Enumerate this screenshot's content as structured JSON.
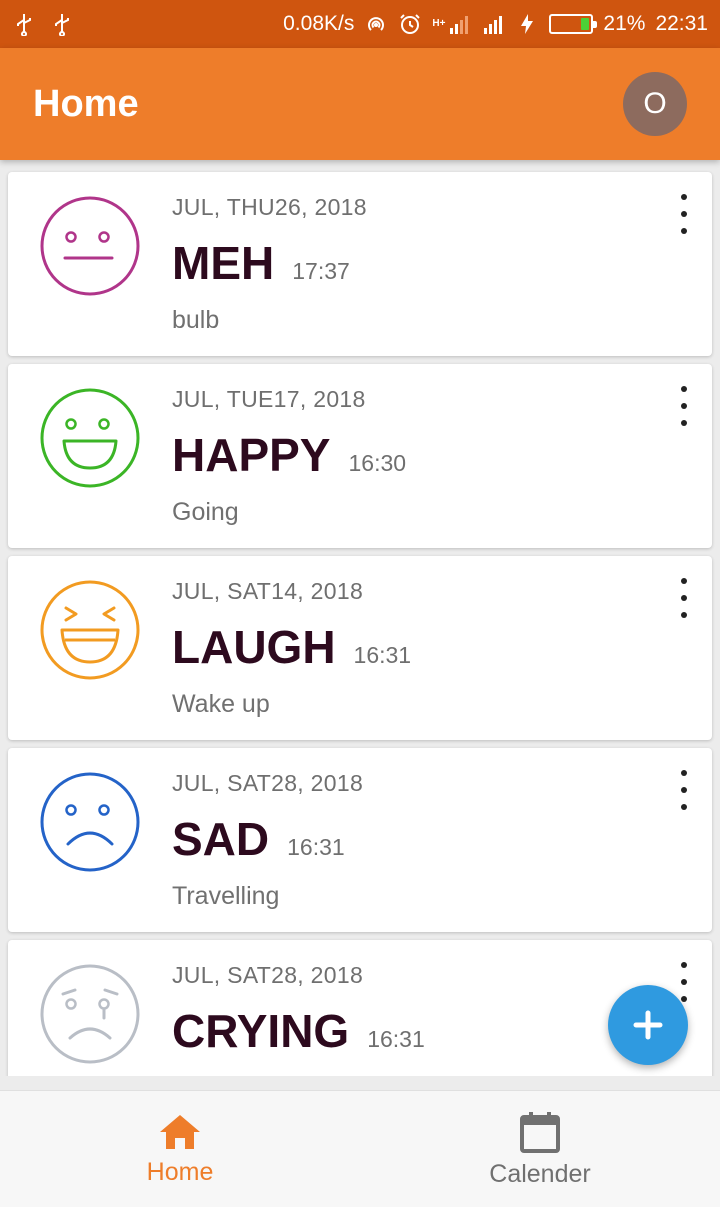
{
  "status_bar": {
    "net_speed": "0.08K/s",
    "battery": "21%",
    "battery_level": 0.21,
    "time": "22:31",
    "network_label": "H+",
    "icons": [
      "usb-icon",
      "usb-icon",
      "hotspot-icon",
      "alarm-icon",
      "signal-icon",
      "signal-icon",
      "charging-icon",
      "battery-icon"
    ]
  },
  "app_bar": {
    "title": "Home",
    "avatar_initial": "O"
  },
  "colors": {
    "primary": "#ee7d2a",
    "status": "#cf550f",
    "fab": "#2f9ae0",
    "avatar": "#8d6b5e",
    "mood_text": "#2d0a1e"
  },
  "entries": [
    {
      "date": "JUL, THU26, 2018",
      "mood": "MEH",
      "time": "17:37",
      "note": "bulb",
      "icon": "meh-face-icon",
      "color": "#b0358a"
    },
    {
      "date": "JUL, TUE17, 2018",
      "mood": "HAPPY",
      "time": "16:30",
      "note": "Going",
      "icon": "happy-face-icon",
      "color": "#3bb526"
    },
    {
      "date": "JUL, SAT14, 2018",
      "mood": "LAUGH",
      "time": "16:31",
      "note": "Wake up",
      "icon": "laugh-face-icon",
      "color": "#f29b21"
    },
    {
      "date": "JUL, SAT28, 2018",
      "mood": "SAD",
      "time": "16:31",
      "note": "Travelling",
      "icon": "sad-face-icon",
      "color": "#2463c8"
    },
    {
      "date": "JUL, SAT28, 2018",
      "mood": "CRYING",
      "time": "16:31",
      "note": "",
      "icon": "crying-face-icon",
      "color": "#b9bec6"
    }
  ],
  "fab": {
    "icon": "plus-icon"
  },
  "bottom_nav": [
    {
      "label": "Home",
      "icon": "home-icon",
      "active": true
    },
    {
      "label": "Calender",
      "icon": "calendar-icon",
      "active": false
    }
  ]
}
